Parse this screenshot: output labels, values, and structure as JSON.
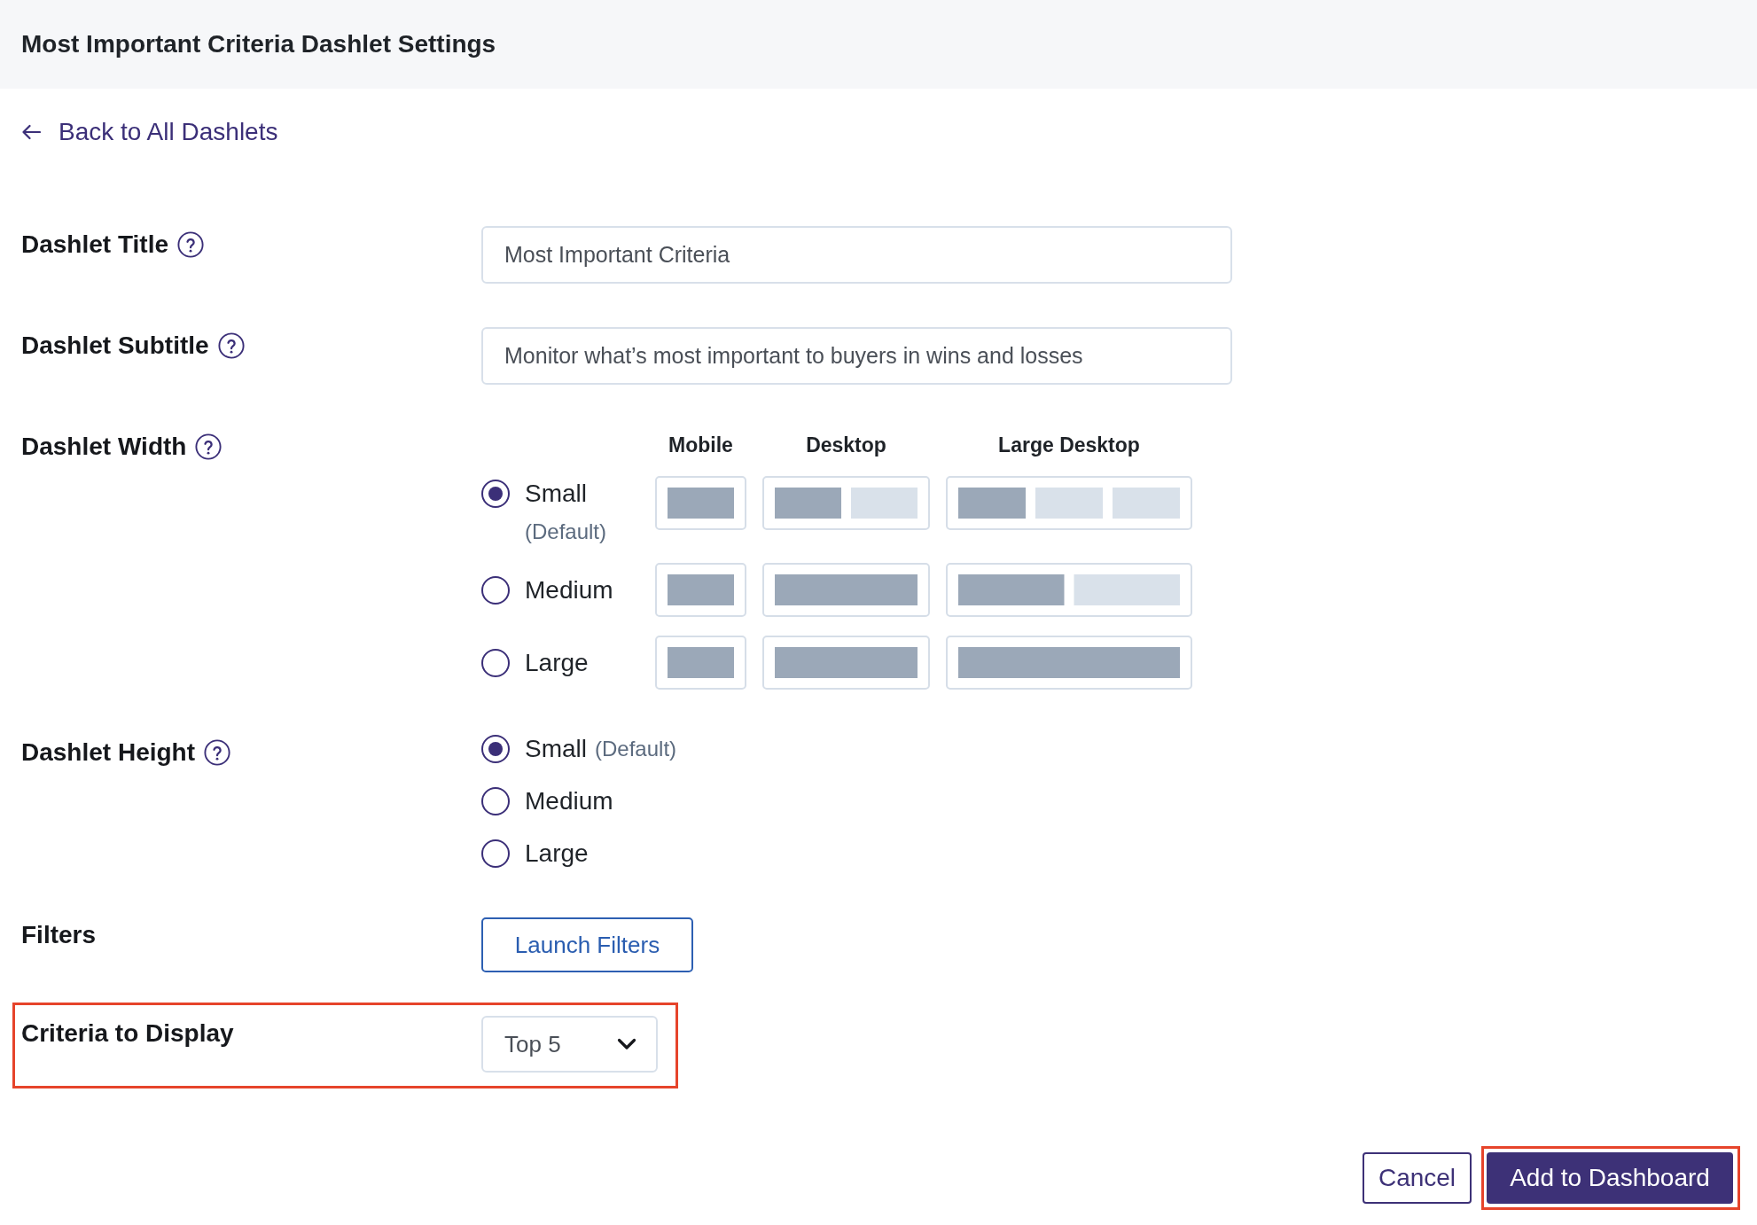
{
  "header": {
    "title": "Most Important Criteria Dashlet Settings"
  },
  "back_link": {
    "label": "Back to All Dashlets"
  },
  "fields": [
    {
      "kind": "text",
      "label": "Dashlet Title",
      "help": true,
      "highlighted": false,
      "value": "Most Important Criteria"
    },
    {
      "kind": "text",
      "label": "Dashlet Subtitle",
      "help": true,
      "highlighted": false,
      "value": "Monitor what’s most important to buyers in wins and losses"
    },
    {
      "kind": "width",
      "label": "Dashlet Width",
      "help": true,
      "highlighted": false,
      "columns": [
        "Mobile",
        "Desktop",
        "Large Desktop"
      ],
      "options": [
        {
          "label": "Small",
          "note": "(Default)",
          "selected": true
        },
        {
          "label": "Medium",
          "selected": false
        },
        {
          "label": "Large",
          "selected": false
        }
      ]
    },
    {
      "kind": "height",
      "label": "Dashlet Height",
      "help": true,
      "highlighted": false,
      "options": [
        {
          "label": "Small",
          "note": "(Default)",
          "selected": true
        },
        {
          "label": "Medium",
          "selected": false
        },
        {
          "label": "Large",
          "selected": false
        }
      ]
    },
    {
      "kind": "button",
      "label": "Filters",
      "help": false,
      "highlighted": false,
      "button": "Launch Filters"
    },
    {
      "kind": "select",
      "label": "Criteria to Display",
      "help": false,
      "highlighted": true,
      "value": "Top 5"
    }
  ],
  "footer": {
    "buttons": [
      {
        "label": "Cancel",
        "kind": "secondary",
        "highlighted": false
      },
      {
        "label": "Add to Dashboard",
        "kind": "primary",
        "highlighted": true
      }
    ]
  }
}
